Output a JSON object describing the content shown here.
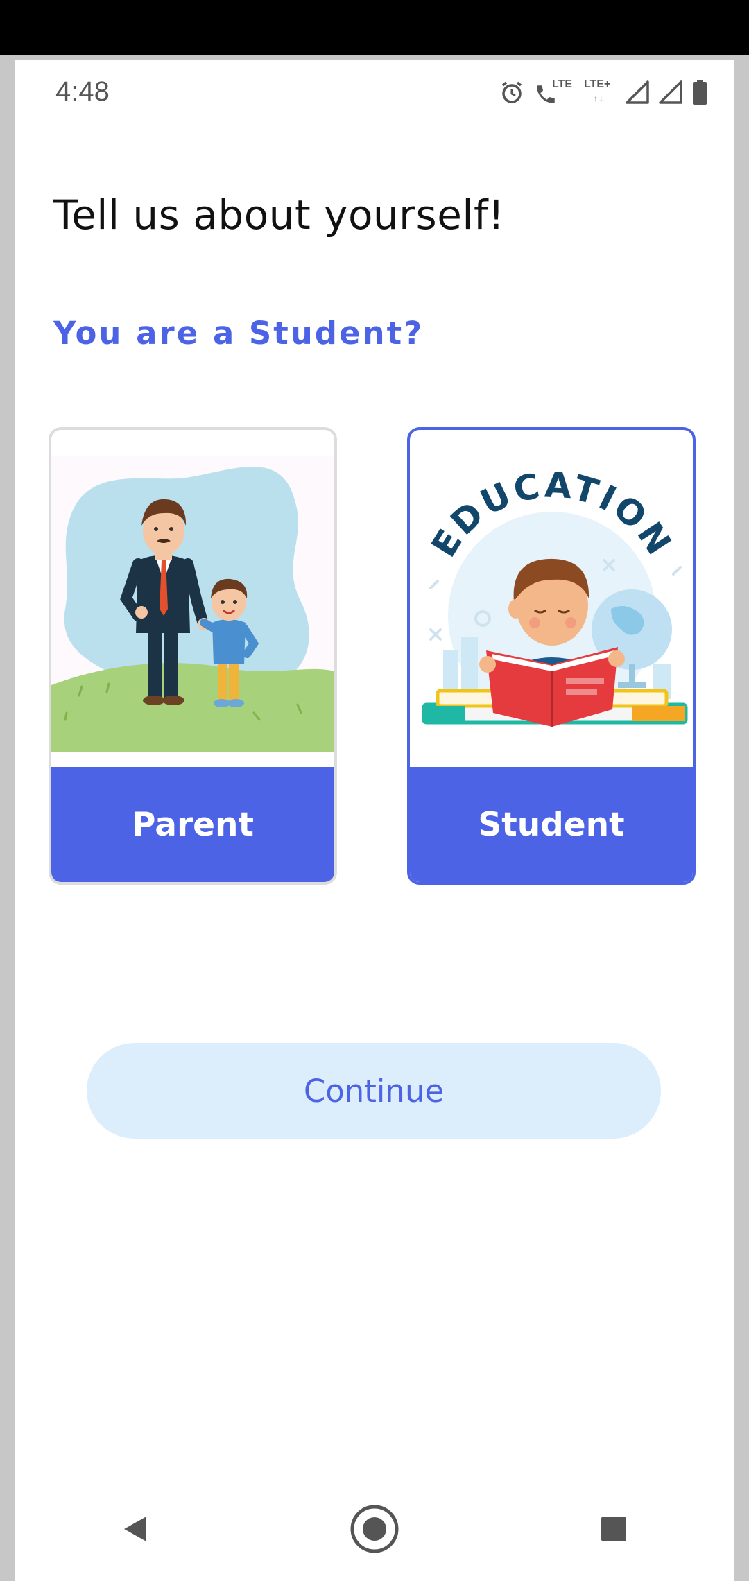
{
  "status_bar": {
    "time": "4:48",
    "icons": [
      "alarm-icon",
      "volte-call-icon",
      "lte-icon",
      "lte-plus-icon",
      "signal-icon",
      "signal-icon",
      "battery-icon"
    ],
    "lte_label": "LTE",
    "lte_plus_label": "LTE+"
  },
  "page": {
    "title": "Tell us about yourself!",
    "question": "You are a Student?"
  },
  "options": [
    {
      "label": "Parent",
      "illustration": "parent-child-illustration",
      "selected": false
    },
    {
      "label": "Student",
      "illustration": "education-reading-illustration",
      "selected": true,
      "art_text": "EDUCATION"
    }
  ],
  "continue_label": "Continue",
  "nav": [
    "back-icon",
    "home-icon",
    "recents-icon"
  ],
  "colors": {
    "accent": "#4c63e6",
    "button_bg": "#dcedfc",
    "unselected_border": "#dcdcdc"
  }
}
